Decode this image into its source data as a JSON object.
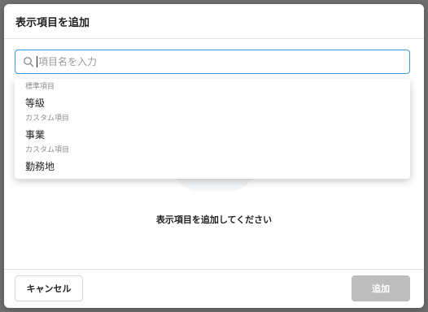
{
  "modal": {
    "title": "表示項目を追加"
  },
  "search": {
    "placeholder": "項目名を入力",
    "icon": "search-icon"
  },
  "dropdown": {
    "groups": [
      {
        "label": "標準項目",
        "options": [
          "等級"
        ]
      },
      {
        "label": "カスタム項目",
        "options": [
          "事業"
        ]
      },
      {
        "label": "カスタム項目",
        "options": [
          "勤務地"
        ]
      }
    ]
  },
  "empty_state": {
    "message": "表示項目を追加してください"
  },
  "footer": {
    "cancel_label": "キャンセル",
    "add_label": "追加"
  },
  "colors": {
    "accent_border": "#3b9ad9",
    "disabled_button": "#bdbdbd",
    "backdrop": "#6f6f6f"
  }
}
